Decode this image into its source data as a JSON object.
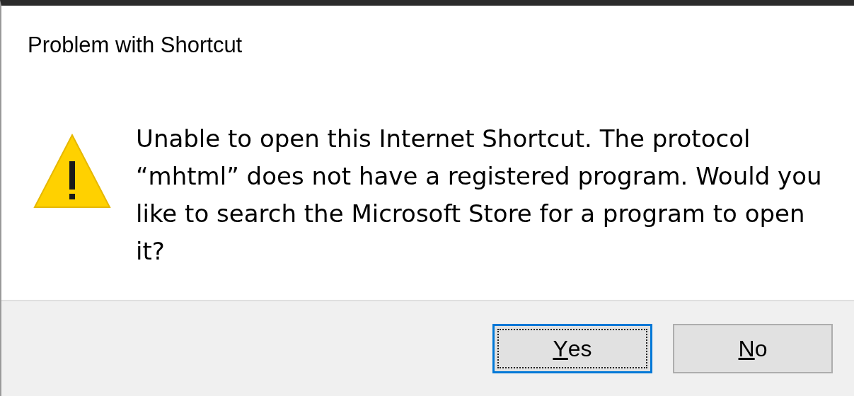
{
  "window": {
    "title": "Problem with Shortcut"
  },
  "message": {
    "text": "Unable to open this Internet Shortcut. The protocol “mhtml” does not have a registered program. Would you like to search the Microsoft Store for a program to open it?"
  },
  "buttons": [
    {
      "label": "Yes",
      "focused": true
    },
    {
      "label": "No",
      "focused": false
    }
  ]
}
